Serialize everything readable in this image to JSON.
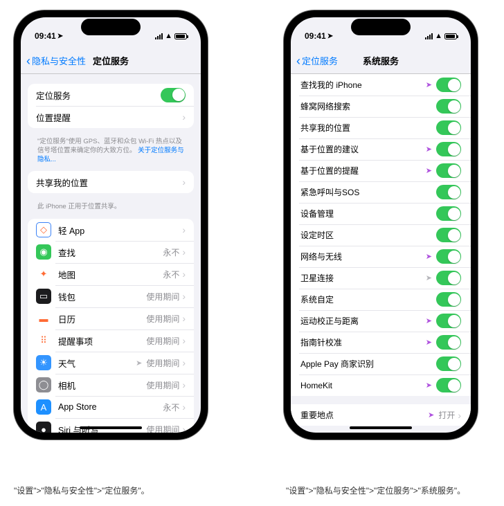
{
  "status": {
    "time": "09:41"
  },
  "left": {
    "back": "隐私与安全性",
    "title": "定位服务",
    "s1_label": "定位服务",
    "s1_toggle": true,
    "s2_label": "位置提醒",
    "foot1_a": "\"定位服务\"使用 GPS、蓝牙和众包 Wi-Fi 热点以及信号塔位置来确定你的大致方位。",
    "foot1_b": "关于定位服务与隐私...",
    "s3_label": "共享我的位置",
    "foot2": "此 iPhone 正用于位置共享。",
    "apps": [
      {
        "name": "轻 App",
        "value": "",
        "loc": "",
        "icon_bg": "#fff",
        "icon_border": "#3b82f6",
        "glyph": "◇"
      },
      {
        "name": "查找",
        "value": "永不",
        "loc": "",
        "icon_bg": "#34c759",
        "glyph": "◉"
      },
      {
        "name": "地图",
        "value": "永不",
        "loc": "",
        "icon_bg": "#fff",
        "glyph": "✦"
      },
      {
        "name": "钱包",
        "value": "使用期间",
        "loc": "",
        "icon_bg": "#1c1c1e",
        "glyph": "▭"
      },
      {
        "name": "日历",
        "value": "使用期间",
        "loc": "",
        "icon_bg": "#fff",
        "glyph": "▬"
      },
      {
        "name": "提醒事项",
        "value": "使用期间",
        "loc": "",
        "icon_bg": "#fff",
        "glyph": "⠿"
      },
      {
        "name": "天气",
        "value": "使用期间",
        "loc": "gray",
        "icon_bg": "#3395ff",
        "glyph": "☀"
      },
      {
        "name": "相机",
        "value": "使用期间",
        "loc": "",
        "icon_bg": "#8e8e93",
        "glyph": "◯"
      },
      {
        "name": "App Store",
        "value": "永不",
        "loc": "",
        "icon_bg": "#1e90ff",
        "glyph": "A"
      },
      {
        "name": "Siri 与听写",
        "value": "使用期间",
        "loc": "",
        "icon_bg": "#1c1c1e",
        "glyph": "●"
      }
    ]
  },
  "right": {
    "back": "定位服务",
    "title": "系统服务",
    "items": [
      {
        "name": "查找我的 iPhone",
        "loc": "purple",
        "toggle": true
      },
      {
        "name": "蜂窝网络搜索",
        "loc": "",
        "toggle": true
      },
      {
        "name": "共享我的位置",
        "loc": "",
        "toggle": true
      },
      {
        "name": "基于位置的建议",
        "loc": "purple",
        "toggle": true
      },
      {
        "name": "基于位置的提醒",
        "loc": "purple",
        "toggle": true
      },
      {
        "name": "紧急呼叫与SOS",
        "loc": "",
        "toggle": true
      },
      {
        "name": "设备管理",
        "loc": "",
        "toggle": true
      },
      {
        "name": "设定时区",
        "loc": "",
        "toggle": true
      },
      {
        "name": "网络与无线",
        "loc": "purple",
        "toggle": true
      },
      {
        "name": "卫星连接",
        "loc": "gray",
        "toggle": true
      },
      {
        "name": "系统自定",
        "loc": "",
        "toggle": true
      },
      {
        "name": "运动校正与距离",
        "loc": "purple",
        "toggle": true
      },
      {
        "name": "指南针校准",
        "loc": "purple",
        "toggle": true
      },
      {
        "name": "Apple Pay 商家识别",
        "loc": "",
        "toggle": true
      },
      {
        "name": "HomeKit",
        "loc": "purple",
        "toggle": true
      }
    ],
    "last": {
      "name": "重要地点",
      "loc": "purple",
      "value": "打开"
    }
  },
  "caption_left": "\"设置\">\"隐私与安全性\">\"定位服务\"。",
  "caption_right": "\"设置\">\"隐私与安全性\">\"定位服务\">\"系统服务\"。"
}
